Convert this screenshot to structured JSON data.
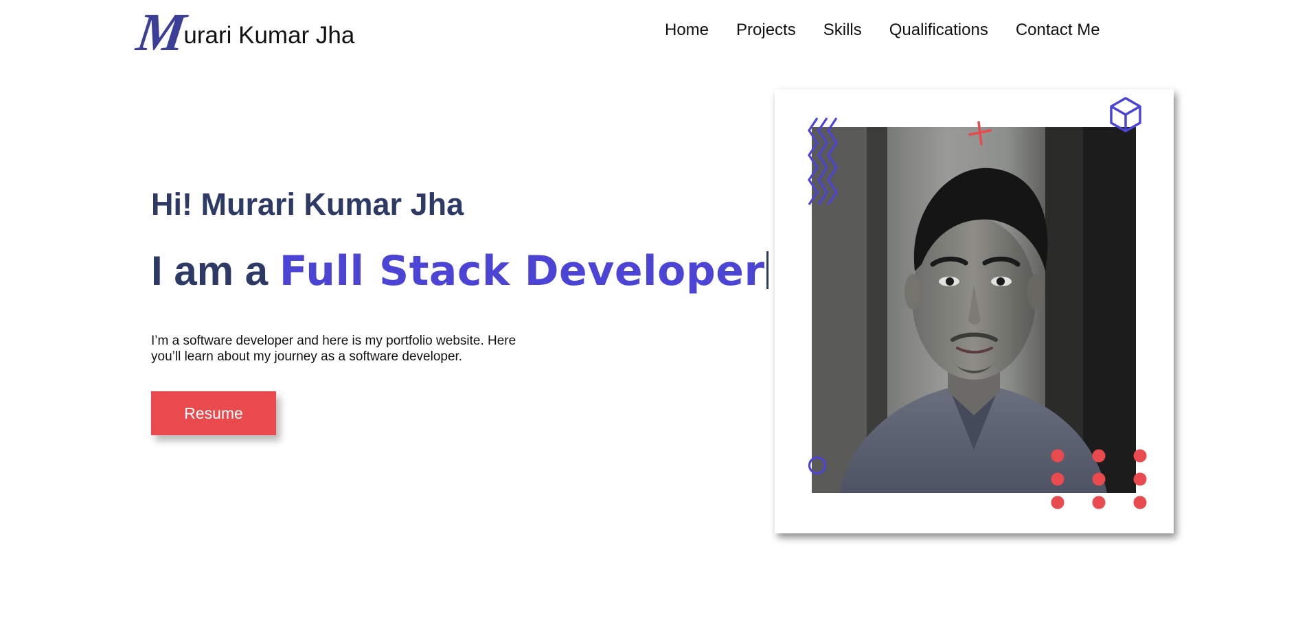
{
  "header": {
    "logo_initial": "M",
    "logo_rest": "urari Kumar Jha",
    "nav": [
      "Home",
      "Projects",
      "Skills",
      "Qualifications",
      "Contact Me"
    ]
  },
  "hero": {
    "greeting": "Hi! Murari Kumar Jha",
    "role_prefix": "I am a ",
    "role_highlight": "Full Stack Developer",
    "intro_line1": "I’m a software developer and here is my portfolio website. Here",
    "intro_line2": "you’ll learn about my journey as a software developer.",
    "resume_label": "Resume"
  },
  "colors": {
    "accent_blue": "#4b44d4",
    "accent_red": "#e84a4d",
    "heading": "#2e3a66",
    "logo": "#3b3f98"
  },
  "decorations": [
    "zigzag-icon",
    "cross-icon",
    "cube-icon",
    "circle-icon",
    "dots-grid-icon"
  ]
}
